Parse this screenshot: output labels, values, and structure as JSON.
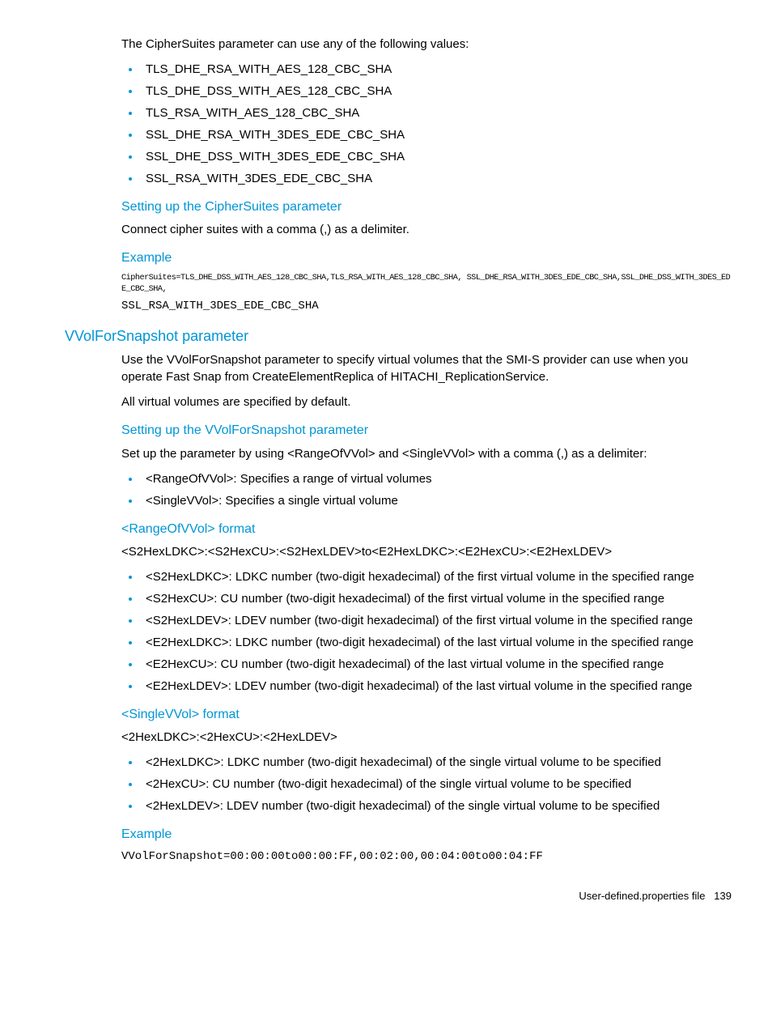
{
  "intro_text": "The CipherSuites parameter can use any of the following values:",
  "cipher_list": [
    "TLS_DHE_RSA_WITH_AES_128_CBC_SHA",
    "TLS_DHE_DSS_WITH_AES_128_CBC_SHA",
    "TLS_RSA_WITH_AES_128_CBC_SHA",
    "SSL_DHE_RSA_WITH_3DES_EDE_CBC_SHA",
    "SSL_DHE_DSS_WITH_3DES_EDE_CBC_SHA",
    "SSL_RSA_WITH_3DES_EDE_CBC_SHA"
  ],
  "cipher_setup_heading": "Setting up the CipherSuites parameter",
  "cipher_setup_text": "Connect cipher suites with a comma (,) as a delimiter.",
  "example_heading": "Example",
  "cipher_example_line1": "CipherSuites=TLS_DHE_DSS_WITH_AES_128_CBC_SHA,TLS_RSA_WITH_AES_128_CBC_SHA, SSL_DHE_RSA_WITH_3DES_EDE_CBC_SHA,SSL_DHE_DSS_WITH_3DES_EDE_CBC_SHA,",
  "cipher_example_line2": "SSL_RSA_WITH_3DES_EDE_CBC_SHA",
  "vvol_heading": "VVolForSnapshot parameter",
  "vvol_intro1": "Use the VVolForSnapshot parameter to specify virtual volumes that the SMI-S provider can use when you operate Fast Snap from CreateElementReplica of HITACHI_ReplicationService.",
  "vvol_intro2": "All virtual volumes are specified by default.",
  "vvol_setup_heading": "Setting up the VVolForSnapshot parameter",
  "vvol_setup_text": "Set up the parameter by using <RangeOfVVol> and <SingleVVol> with a comma (,) as a delimiter:",
  "vvol_setup_list": [
    "<RangeOfVVol>: Specifies a range of virtual volumes",
    "<SingleVVol>: Specifies a single virtual volume"
  ],
  "range_heading": "<RangeOfVVol> format",
  "range_format": "<S2HexLDKC>:<S2HexCU>:<S2HexLDEV>to<E2HexLDKC>:<E2HexCU>:<E2HexLDEV>",
  "range_list": [
    "<S2HexLDKC>: LDKC number (two-digit hexadecimal) of the first virtual volume in the specified range",
    "<S2HexCU>: CU number (two-digit hexadecimal) of the first virtual volume in the specified range",
    "<S2HexLDEV>: LDEV number (two-digit hexadecimal) of the first virtual volume in the specified range",
    "<E2HexLDKC>: LDKC number (two-digit hexadecimal) of the last virtual volume in the specified range",
    "<E2HexCU>: CU number (two-digit hexadecimal) of the last virtual volume in the specified range",
    "<E2HexLDEV>: LDEV number (two-digit hexadecimal) of the last virtual volume in the specified range"
  ],
  "single_heading": "<SingleVVol> format",
  "single_format": "<2HexLDKC>:<2HexCU>:<2HexLDEV>",
  "single_list": [
    "<2HexLDKC>: LDKC number (two-digit hexadecimal) of the single virtual volume to be specified",
    "<2HexCU>: CU number (two-digit hexadecimal) of the single virtual volume to be specified",
    "<2HexLDEV>: LDEV number (two-digit hexadecimal) of the single virtual volume to be specified"
  ],
  "vvol_example": "VVolForSnapshot=00:00:00to00:00:FF,00:02:00,00:04:00to00:04:FF",
  "footer_text": "User-defined.properties file",
  "footer_page": "139"
}
